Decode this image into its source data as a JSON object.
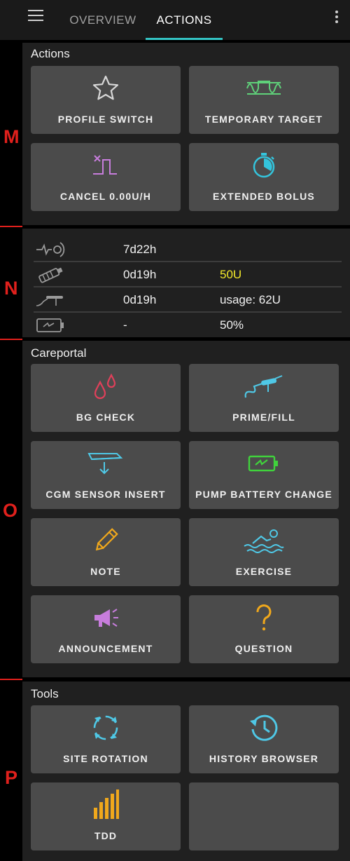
{
  "header": {
    "tabs": [
      {
        "label": "OVERVIEW",
        "active": false
      },
      {
        "label": "ACTIONS",
        "active": true
      }
    ],
    "accent_color": "#34c4c4"
  },
  "markers": [
    "M",
    "N",
    "O",
    "P"
  ],
  "actions": {
    "title": "Actions",
    "items": [
      {
        "label": "PROFILE SWITCH",
        "icon": "star-icon"
      },
      {
        "label": "TEMPORARY TARGET",
        "icon": "temp-target-icon"
      },
      {
        "label": "CANCEL 0.00U/H",
        "icon": "cancel-temp-basal-icon"
      },
      {
        "label": "EXTENDED BOLUS",
        "icon": "stopwatch-icon"
      }
    ]
  },
  "status": {
    "rows": [
      {
        "icon": "cannula-icon",
        "age": "7d22h",
        "value": ""
      },
      {
        "icon": "insulin-reservoir-icon",
        "age": "0d19h",
        "value": "50U",
        "value_color": "#f3e92a"
      },
      {
        "icon": "cgm-sensor-icon",
        "age": "0d19h",
        "value": "usage: 62U"
      },
      {
        "icon": "pump-battery-icon",
        "age": "-",
        "value": "50%"
      }
    ]
  },
  "careportal": {
    "title": "Careportal",
    "items": [
      {
        "label": "BG CHECK",
        "icon": "blood-drops-icon"
      },
      {
        "label": "PRIME/FILL",
        "icon": "prime-fill-icon"
      },
      {
        "label": "CGM SENSOR INSERT",
        "icon": "sensor-insert-icon"
      },
      {
        "label": "PUMP BATTERY CHANGE",
        "icon": "battery-change-icon"
      },
      {
        "label": "NOTE",
        "icon": "pencil-icon"
      },
      {
        "label": "EXERCISE",
        "icon": "swimmer-icon"
      },
      {
        "label": "ANNOUNCEMENT",
        "icon": "megaphone-icon"
      },
      {
        "label": "QUESTION",
        "icon": "question-icon"
      }
    ]
  },
  "tools": {
    "title": "Tools",
    "items": [
      {
        "label": "SITE ROTATION",
        "icon": "site-rotation-icon"
      },
      {
        "label": "HISTORY BROWSER",
        "icon": "history-icon"
      },
      {
        "label": "TDD",
        "icon": "bar-chart-icon"
      },
      {
        "label": "",
        "icon": ""
      }
    ]
  },
  "colors": {
    "card": "#4b4b4b",
    "section": "#202020",
    "marker": "#e0201c"
  }
}
